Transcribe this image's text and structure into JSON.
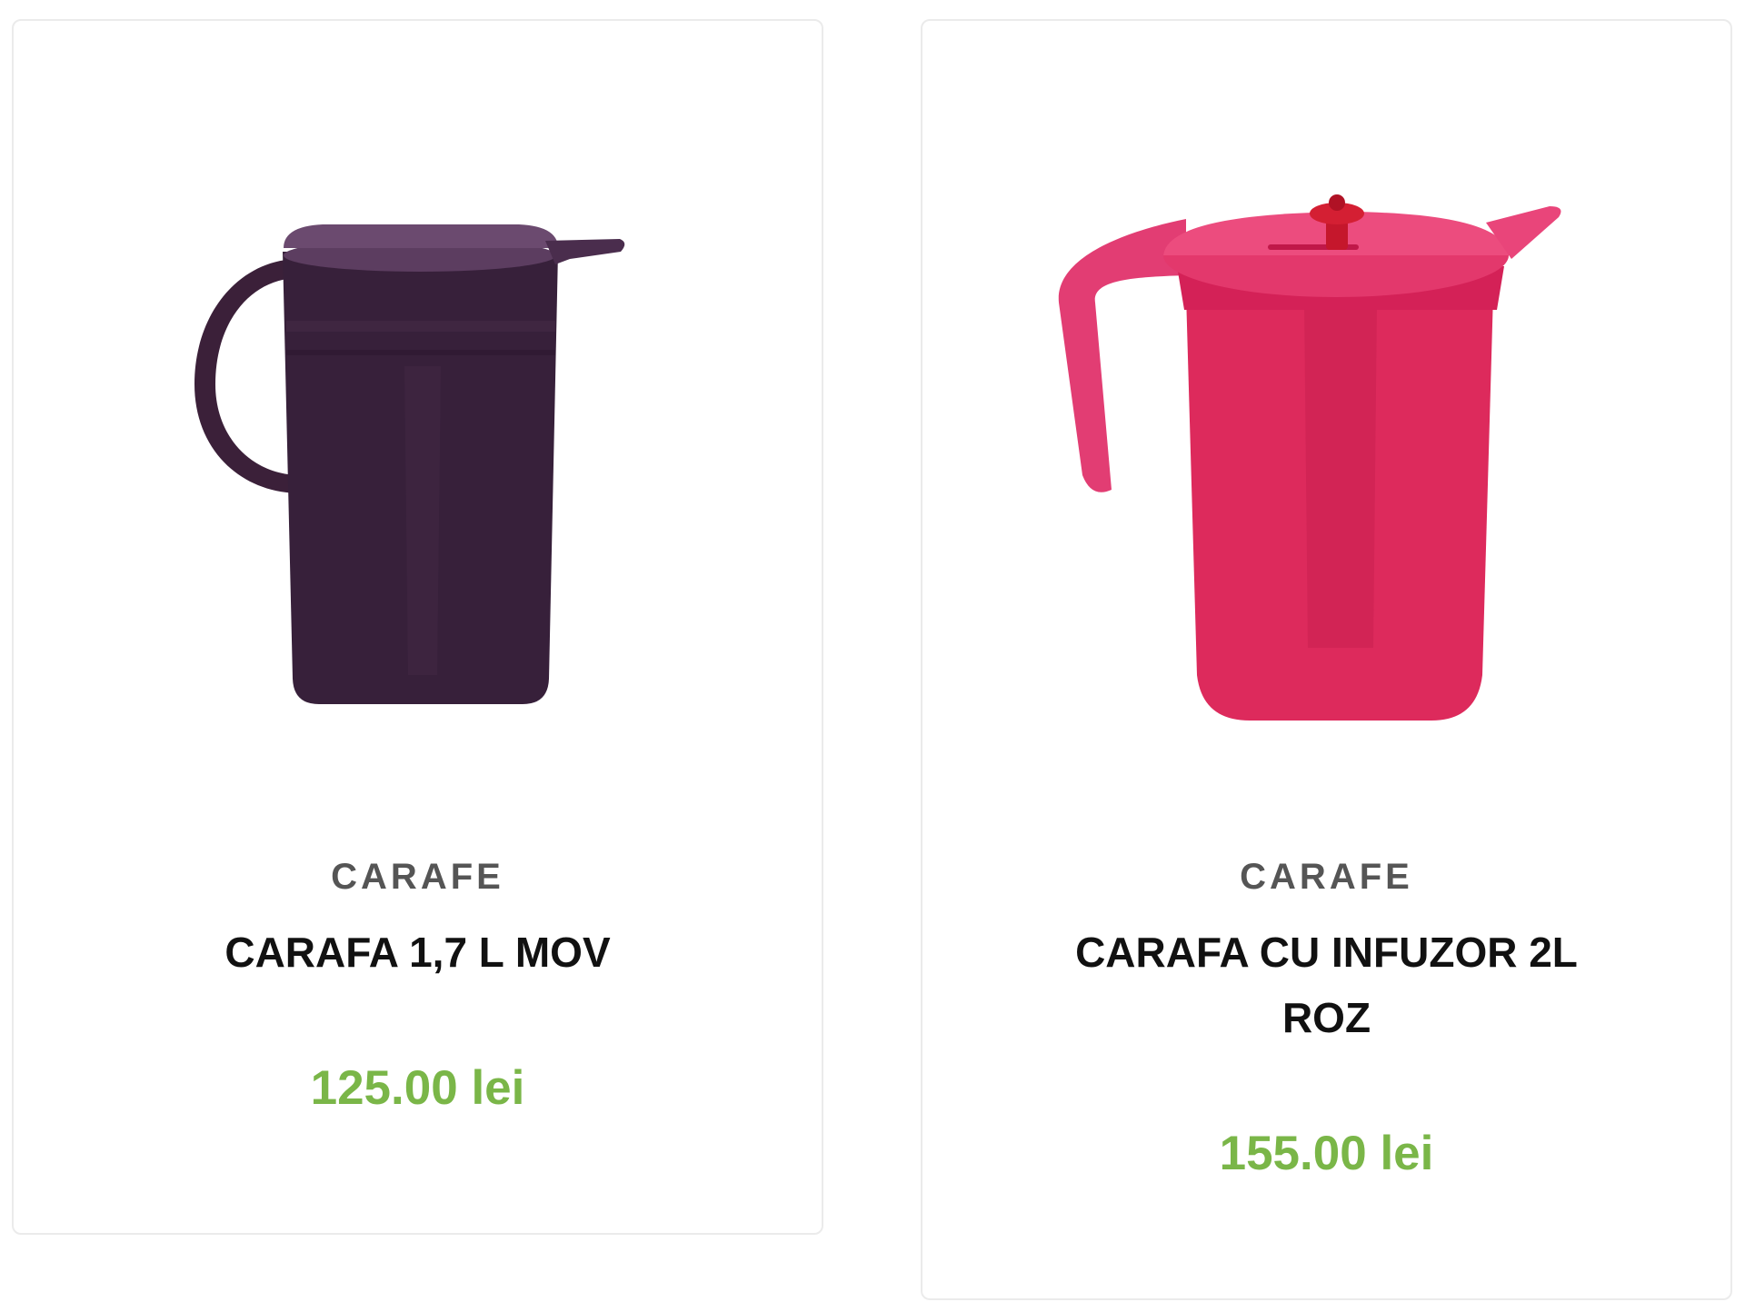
{
  "colors": {
    "category_text": "#555555",
    "title_text": "#111111",
    "price_text": "#7ab648",
    "card_border": "#ebebeb",
    "card_background": "#ffffff"
  },
  "products": [
    {
      "image": "purple-pitcher-image",
      "product_color": "#3a1f3b",
      "category": "CARAFE",
      "title": "CARAFA 1,7 L MOV",
      "price": "125.00 lei"
    },
    {
      "image": "pink-infuser-pitcher-image",
      "product_color": "#dd2a5c",
      "category": "CARAFE",
      "title": "CARAFA CU INFUZOR 2L ROZ",
      "price": "155.00 lei"
    }
  ]
}
